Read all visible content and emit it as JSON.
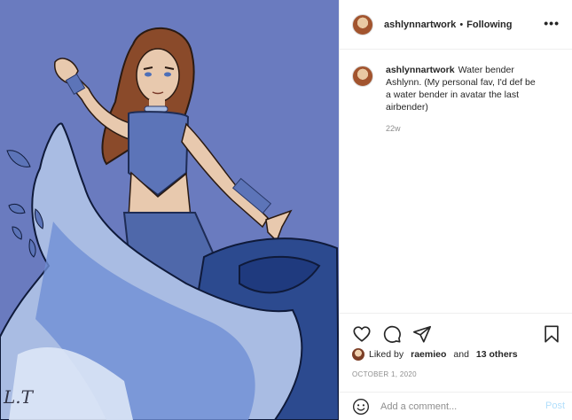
{
  "post": {
    "artwork": {
      "description_icon": "artwork-image",
      "background_color": "#6a7bbf",
      "signature": "L.T"
    },
    "header": {
      "username": "ashlynnartwork",
      "separator": "•",
      "follow_status": "Following",
      "more_icon": "more-icon"
    },
    "caption": {
      "username": "ashlynnartwork",
      "text": "Water bender Ashlynn. (My personal fav, I'd def be a water bender in avatar the last airbender)",
      "time_ago": "22w"
    },
    "actions": {
      "icons": [
        "heart-icon",
        "comment-icon",
        "share-icon",
        "bookmark-icon"
      ]
    },
    "likes": {
      "prefix": "Liked by",
      "user": "raemieo",
      "conjunction": "and",
      "others": "13 others"
    },
    "date": "OCTOBER 1, 2020",
    "comment": {
      "placeholder": "Add a comment...",
      "post_label": "Post",
      "emoji_icon": "emoji-icon"
    },
    "colors": {
      "text": "#262626",
      "muted": "#8e8e8e",
      "post_disabled": "#b2dffc",
      "border": "#efefef"
    }
  }
}
